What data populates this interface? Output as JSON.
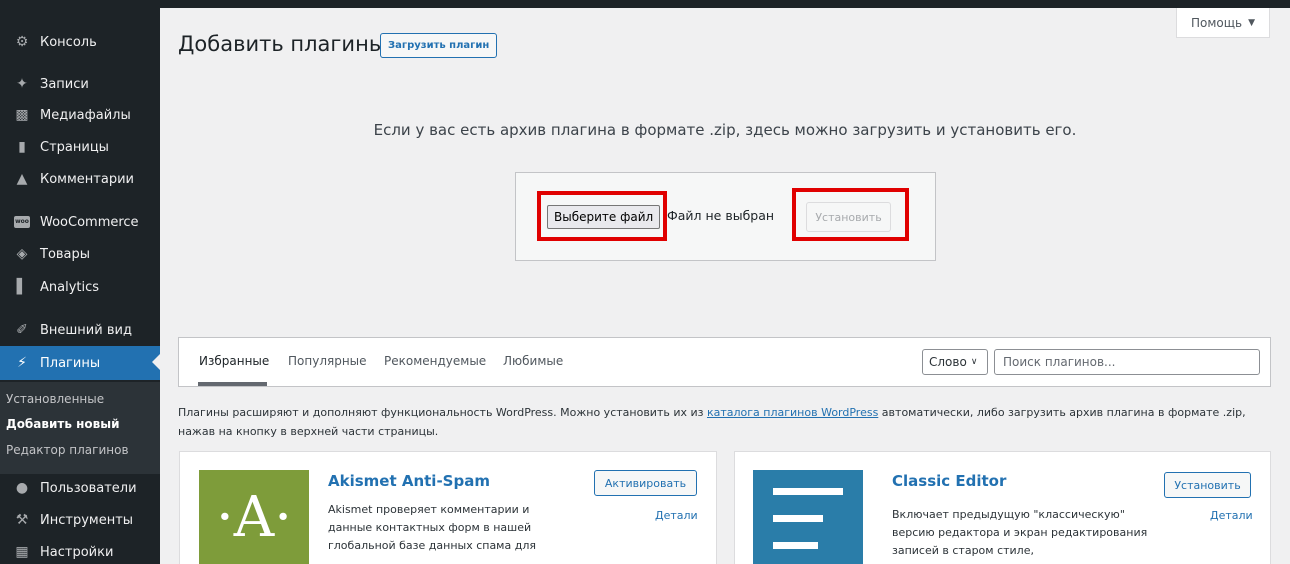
{
  "sidebar": {
    "items": [
      {
        "label": "Консоль",
        "icon": "dashboard-icon"
      },
      {
        "label": "Записи",
        "icon": "pin-icon"
      },
      {
        "label": "Медиафайлы",
        "icon": "media-icon"
      },
      {
        "label": "Страницы",
        "icon": "pages-icon"
      },
      {
        "label": "Комментарии",
        "icon": "comments-icon"
      },
      {
        "label": "WooCommerce",
        "icon": "woo-icon",
        "icon_text": "woo"
      },
      {
        "label": "Товары",
        "icon": "products-icon"
      },
      {
        "label": "Analytics",
        "icon": "analytics-icon"
      },
      {
        "label": "Внешний вид",
        "icon": "appearance-icon"
      },
      {
        "label": "Плагины",
        "icon": "plugins-icon"
      },
      {
        "label": "Пользователи",
        "icon": "users-icon"
      },
      {
        "label": "Инструменты",
        "icon": "tools-icon"
      },
      {
        "label": "Настройки",
        "icon": "settings-icon"
      }
    ],
    "submenu": [
      "Установленные",
      "Добавить новый",
      "Редактор плагинов"
    ]
  },
  "header": {
    "help_label": "Помощь",
    "title": "Добавить плагины",
    "upload_button": "Загрузить плагин"
  },
  "upload": {
    "help_text": "Если у вас есть архив плагина в формате .zip, здесь можно загрузить и установить его.",
    "choose_file_label": "Выберите файл",
    "file_status": "Файл не выбран",
    "install_label": "Установить"
  },
  "filter": {
    "tabs": [
      "Избранные",
      "Популярные",
      "Рекомендуемые",
      "Любимые"
    ],
    "search_type": "Слово",
    "search_placeholder": "Поиск плагинов..."
  },
  "description": {
    "before": "Плагины расширяют и дополняют функциональность WordPress. Можно установить их из ",
    "link": "каталога плагинов WordPress",
    "after": " автоматически, либо загрузить архив плагина в формате .zip, нажав на кнопку в верхней части страницы."
  },
  "cards": [
    {
      "title": "Akismet Anti-Spam",
      "text": "Akismet проверяет комментарии и данные контактных форм в нашей глобальной базе данных спама для",
      "action": "Активировать",
      "details": "Детали",
      "logo_letter": "·A·"
    },
    {
      "title": "Classic Editor",
      "text": "Включает предыдущую \"классическую\" версию редактора и экран редактирования записей в старом стиле,",
      "action": "Установить",
      "details": "Детали"
    }
  ],
  "colors": {
    "sidebar_bg": "#1d2327",
    "accent": "#2271b1",
    "highlight": "#e00000",
    "akismet_green": "#7e9c3a",
    "classic_blue": "#2a7da9"
  }
}
